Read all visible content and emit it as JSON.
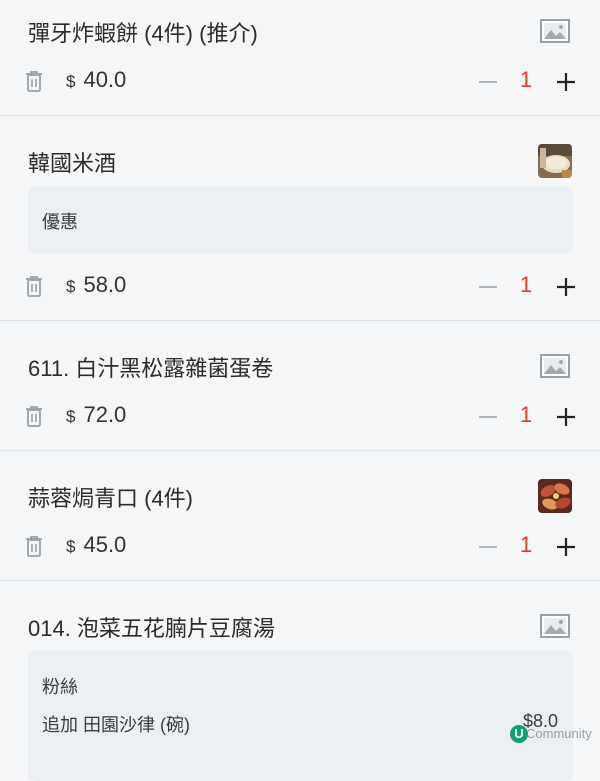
{
  "currency_symbol": "$",
  "items": [
    {
      "title": "彈牙炸蝦餅 (4件) (推介)",
      "price": "40.0",
      "qty": "1",
      "thumb": "image-placeholder-icon"
    },
    {
      "title": "韓國米酒",
      "note": "優惠",
      "price": "58.0",
      "qty": "1",
      "thumb": "rice-wine-photo"
    },
    {
      "title": "611. 白汁黑松露雜菌蛋卷",
      "price": "72.0",
      "qty": "1",
      "thumb": "image-placeholder-icon"
    },
    {
      "title": "蒜蓉焗青口 (4件)",
      "price": "45.0",
      "qty": "1",
      "thumb": "mussels-photo"
    },
    {
      "title": "014. 泡菜五花腩片豆腐湯",
      "notes": [
        "粉絲",
        "追加 田園沙律 (碗)"
      ],
      "note_price": "$8.0",
      "thumb": "image-placeholder-icon"
    }
  ],
  "watermark": {
    "logo_letter": "U",
    "text": "Community"
  },
  "colors": {
    "quantity": "#e53935",
    "divider": "#dfe4ea",
    "background": "#f5f6f8",
    "note_bg": "#eceff2"
  }
}
